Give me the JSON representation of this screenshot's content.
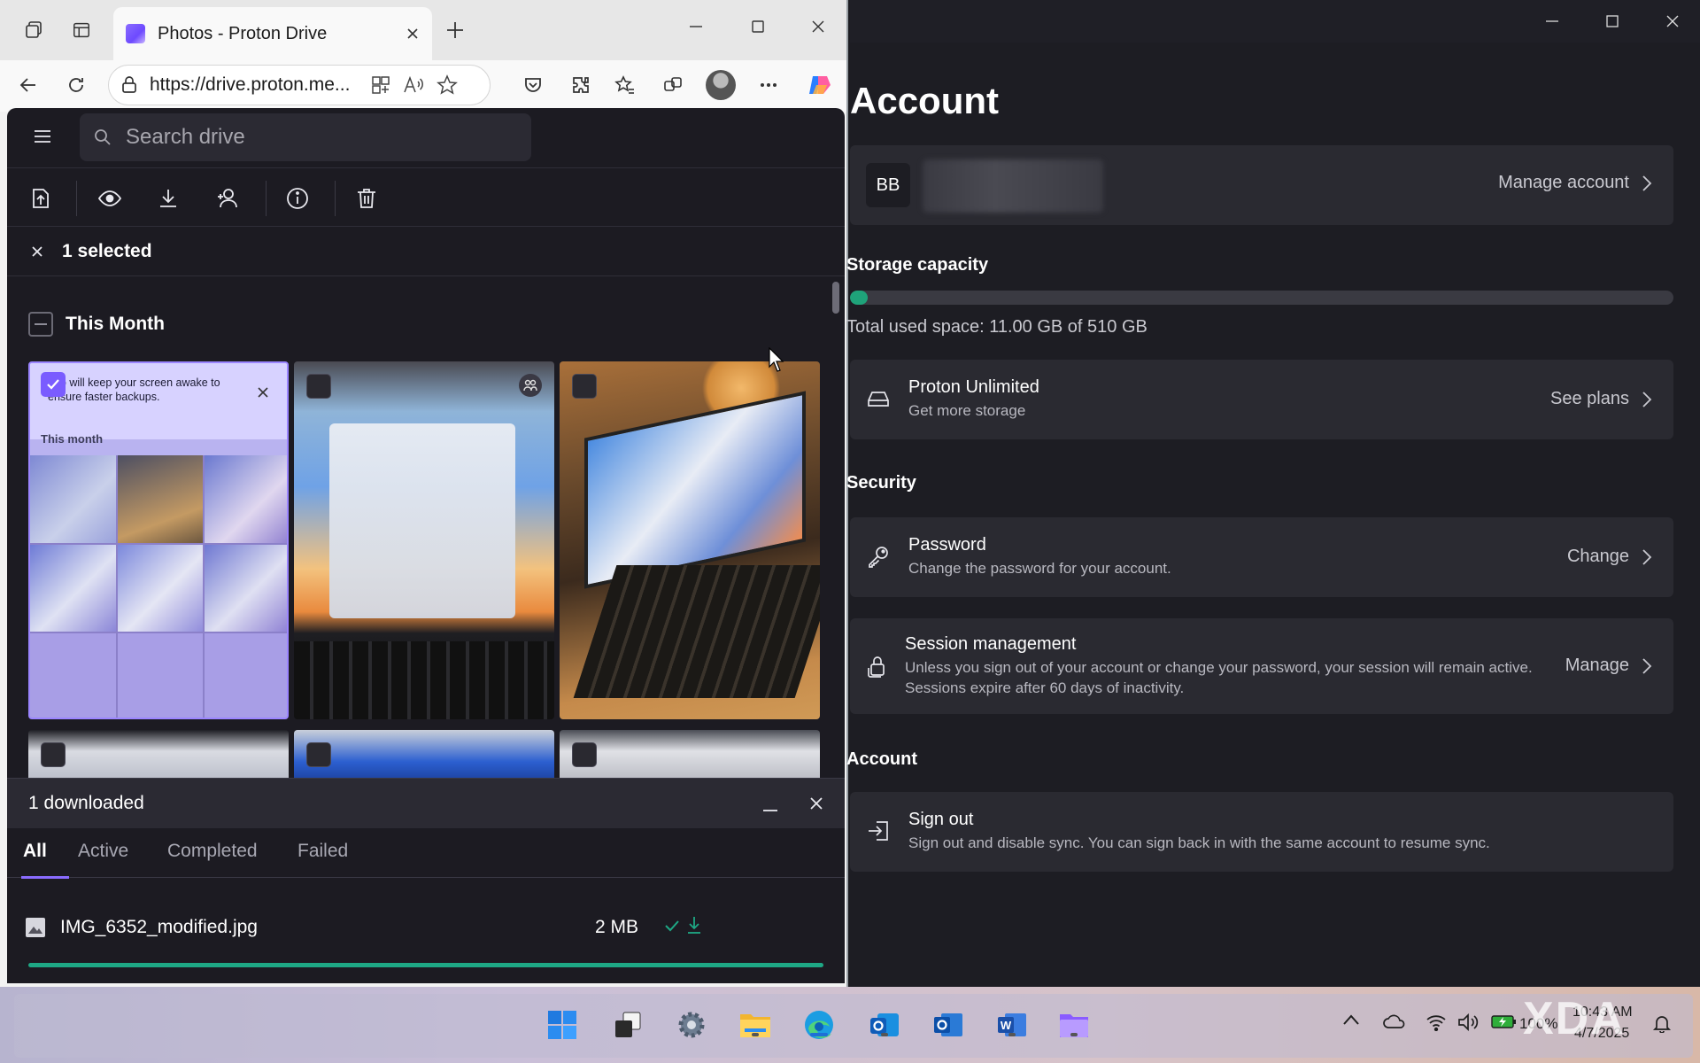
{
  "browser": {
    "tab_title": "Photos - Proton Drive",
    "url": "https://drive.proton.me...",
    "search_placeholder": "Search drive",
    "selection_label": "1 selected",
    "section_title": "This Month",
    "photo1_banner_text": "app will keep your screen awake to ensure faster backups.",
    "photo1_subheading": "This month",
    "downloads": {
      "header": "1 downloaded",
      "tabs": [
        "All",
        "Active",
        "Completed",
        "Failed"
      ],
      "active_tab": "All",
      "item": {
        "name": "IMG_6352_modified.jpg",
        "size": "2 MB",
        "progress": 1.0
      }
    }
  },
  "account": {
    "title": "Account",
    "avatar_initials": "BB",
    "manage_account": "Manage account",
    "storage_heading": "Storage capacity",
    "storage_used_fraction": 0.0216,
    "storage_text": "Total used space: 11.00 GB of 510 GB",
    "plan": {
      "title": "Proton Unlimited",
      "subtitle": "Get more storage",
      "action": "See plans"
    },
    "security_heading": "Security",
    "password": {
      "title": "Password",
      "subtitle": "Change the password for your account.",
      "action": "Change"
    },
    "session": {
      "title": "Session management",
      "subtitle": "Unless you sign out of your account or change your password, your session will remain active. Sessions expire after 60 days of inactivity.",
      "action": "Manage"
    },
    "account_heading": "Account",
    "signout": {
      "title": "Sign out",
      "subtitle": "Sign out and disable sync. You can sign back in with the same account to resume sync."
    }
  },
  "taskbar": {
    "battery": "100%",
    "time": "10:43 AM",
    "date": "4/7/2025",
    "watermark": "XDA"
  },
  "colors": {
    "accent": "#8a6cff",
    "progress": "#1ea885",
    "storage_bar": "#1fa37a"
  }
}
